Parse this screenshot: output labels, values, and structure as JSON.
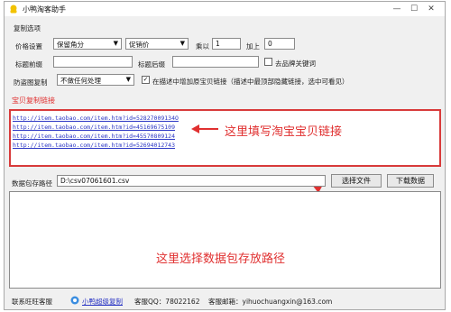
{
  "window": {
    "title": "小鸭淘客助手"
  },
  "copy_options": {
    "heading": "复制选项",
    "price_label": "价格设置",
    "price_mode": "保留角分",
    "price_source": "促销价",
    "multiply_label": "乘以",
    "multiply_value": "1",
    "add_label": "加上",
    "add_value": "0",
    "title_prefix_label": "标题前缀",
    "title_prefix_value": "",
    "title_suffix_label": "标题后缀",
    "title_suffix_value": "",
    "remove_brand_label": "去品牌关键词",
    "anti_theft_label": "防盗图复制",
    "anti_theft_value": "不做任何处理",
    "add_link_label": "在描述中增加原宝贝链接（描述中最顶部隐藏链接，选中可看见）"
  },
  "link_section": {
    "heading": "宝贝复制链接",
    "links": [
      "http://item.taobao.com/item.htm?id=52827009134O",
      "http://item.taobao.com/item.htm?id=45169675109",
      "http://item.taobao.com/item.htm?id=45570809124",
      "http://item.taobao.com/item.htm?id=52694012743"
    ]
  },
  "data_path": {
    "label": "数据包存路径",
    "value": "D:\\csv07061601.csv",
    "select_file_button": "选择文件",
    "download_button": "下载数据"
  },
  "annotations": {
    "link_hint": "这里填写淘宝宝贝链接",
    "path_hint": "这里选择数据包存放路径"
  },
  "footer": {
    "contact_label": "联系旺旺客服",
    "wangwang_link": "小鸭超级复制",
    "qq_label": "客服QQ：78022162",
    "email_label": "客服邮箱：yihuochuangxin@163.com"
  },
  "colors": {
    "annotation": "#e03030",
    "link": "#2a35c4",
    "section_heading": "#e03030"
  }
}
